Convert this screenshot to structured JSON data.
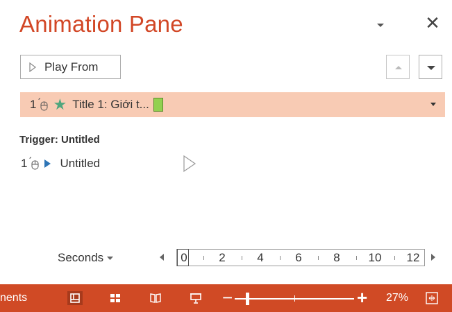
{
  "pane": {
    "title": "Animation Pane",
    "play_from_label": "Play From"
  },
  "animation_item": {
    "order": "1",
    "label": "Title 1: Giới t..."
  },
  "trigger": {
    "heading": "Trigger: Untitled",
    "item_order": "1",
    "item_label": "Untitled"
  },
  "timeline": {
    "unit_label": "Seconds",
    "ticks": [
      "0",
      "2",
      "4",
      "6",
      "8",
      "10",
      "12"
    ]
  },
  "statusbar": {
    "left_text": "nents",
    "zoom": "27%"
  },
  "colors": {
    "title": "#d24726",
    "selected_row": "#f8cbb4",
    "star": "#4fa67d",
    "timing_bar": "#92d050",
    "trigger_arrow": "#2e75b6",
    "statusbar": "#d04a25"
  }
}
